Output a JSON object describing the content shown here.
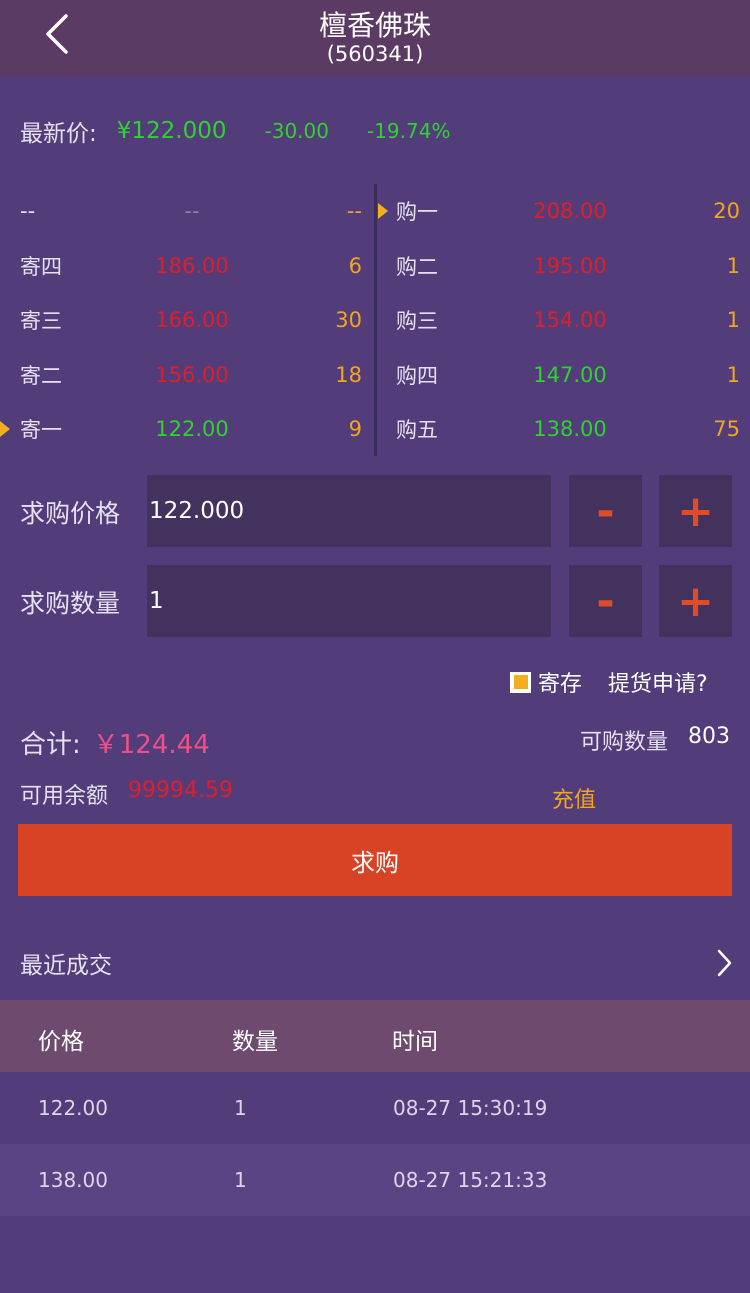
{
  "header": {
    "title": "檀香佛珠",
    "code": "(560341)"
  },
  "quote": {
    "label": "最新价:",
    "price": "¥122.000",
    "change": "-30.00",
    "change_pct": "-19.74%"
  },
  "order_book": {
    "sell": [
      {
        "name": "--",
        "price": "--",
        "vol": "--"
      },
      {
        "name": "寄四",
        "price": "186.00",
        "vol": "6"
      },
      {
        "name": "寄三",
        "price": "166.00",
        "vol": "30"
      },
      {
        "name": "寄二",
        "price": "156.00",
        "vol": "18"
      },
      {
        "name": "寄一",
        "price": "122.00",
        "vol": "9"
      }
    ],
    "buy": [
      {
        "name": "购一",
        "price": "208.00",
        "vol": "20"
      },
      {
        "name": "购二",
        "price": "195.00",
        "vol": "1"
      },
      {
        "name": "购三",
        "price": "154.00",
        "vol": "1"
      },
      {
        "name": "购四",
        "price": "147.00",
        "vol": "1"
      },
      {
        "name": "购五",
        "price": "138.00",
        "vol": "75"
      }
    ]
  },
  "form": {
    "price_label": "求购价格",
    "price_value": "122.000",
    "qty_label": "求购数量",
    "qty_value": "1",
    "minus": "-",
    "plus": "+"
  },
  "options": {
    "deposit_label": "寄存",
    "deposit_checked": true,
    "pickup_label": "提货申请?"
  },
  "summary": {
    "total_label": "合计:",
    "total_value": "￥124.44",
    "avail_qty_label": "可购数量",
    "avail_qty_value": "803",
    "balance_label": "可用余额",
    "balance_value": "99994.59",
    "recharge_label": "充值"
  },
  "submit_label": "求购",
  "recent": {
    "title": "最近成交",
    "columns": [
      "价格",
      "数量",
      "时间"
    ],
    "rows": [
      {
        "price": "122.00",
        "qty": "1",
        "time": "08-27 15:30:19"
      },
      {
        "price": "138.00",
        "qty": "1",
        "time": "08-27 15:21:33"
      }
    ]
  },
  "colors": {
    "background": "#523c7a",
    "header_bg": "#5b3a63",
    "up_red": "#dd1f2a",
    "down_green": "#2fd22f",
    "volume_orange": "#f2a51f",
    "button_orange": "#d84325",
    "total_pink": "#ee4f86"
  }
}
